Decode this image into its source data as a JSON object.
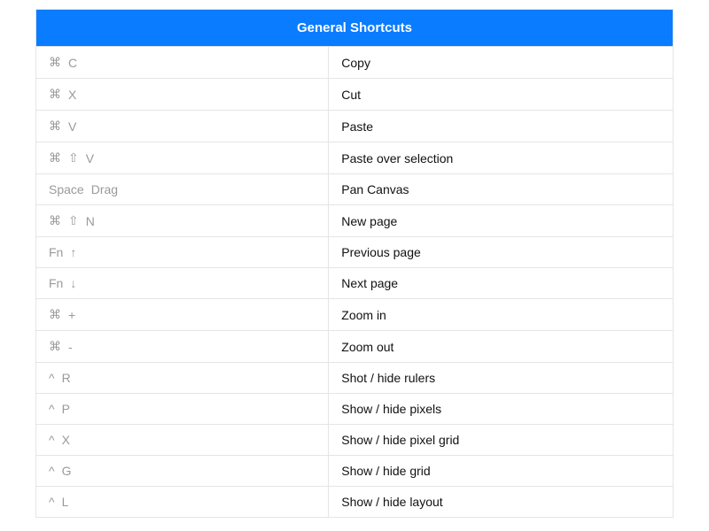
{
  "title": "General Shortcuts",
  "symbols": {
    "cmd": "⌘",
    "shift": "⇧",
    "ctrl": "^",
    "up": "↑",
    "down": "↓"
  },
  "rows": [
    {
      "keys": [
        "cmd",
        "C"
      ],
      "action": "Copy"
    },
    {
      "keys": [
        "cmd",
        "X"
      ],
      "action": "Cut"
    },
    {
      "keys": [
        "cmd",
        "V"
      ],
      "action": "Paste"
    },
    {
      "keys": [
        "cmd",
        "shift",
        "V"
      ],
      "action": "Paste over selection"
    },
    {
      "keys": [
        "Space",
        "Drag"
      ],
      "action": "Pan Canvas"
    },
    {
      "keys": [
        "cmd",
        "shift",
        "N"
      ],
      "action": "New page"
    },
    {
      "keys": [
        "Fn",
        "up"
      ],
      "action": "Previous page"
    },
    {
      "keys": [
        "Fn",
        "down"
      ],
      "action": "Next page"
    },
    {
      "keys": [
        "cmd",
        "+"
      ],
      "action": "Zoom in"
    },
    {
      "keys": [
        "cmd",
        "-"
      ],
      "action": "Zoom out"
    },
    {
      "keys": [
        "ctrl",
        "R"
      ],
      "action": "Shot / hide rulers"
    },
    {
      "keys": [
        "ctrl",
        "P"
      ],
      "action": "Show / hide pixels"
    },
    {
      "keys": [
        "ctrl",
        "X"
      ],
      "action": "Show / hide pixel grid"
    },
    {
      "keys": [
        "ctrl",
        "G"
      ],
      "action": "Show / hide grid"
    },
    {
      "keys": [
        "ctrl",
        "L"
      ],
      "action": "Show / hide layout"
    }
  ]
}
